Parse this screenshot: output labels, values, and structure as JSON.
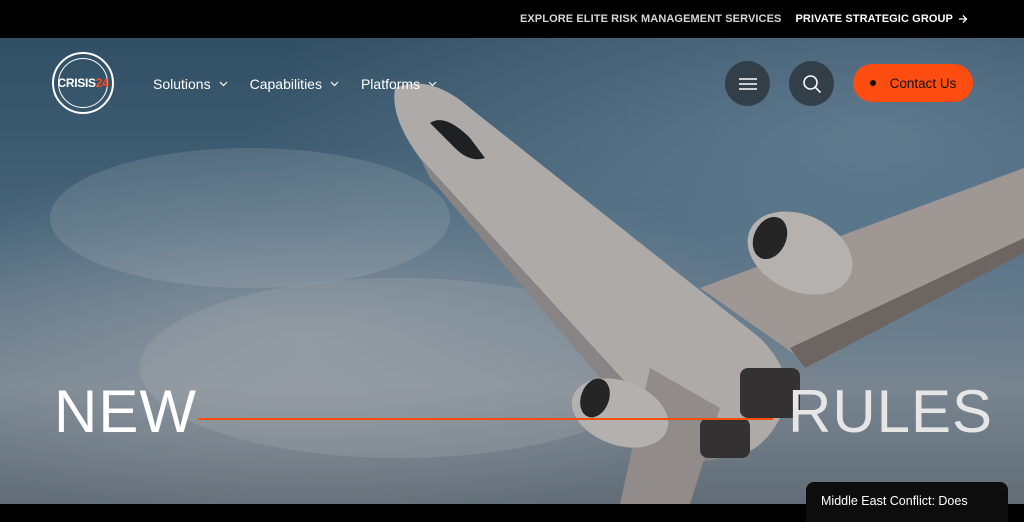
{
  "topbar": {
    "link1": "EXPLORE ELITE RISK MANAGEMENT SERVICES",
    "link2": "PRIVATE STRATEGIC GROUP"
  },
  "logo": {
    "text": "CRISIS",
    "number": "24"
  },
  "nav": [
    {
      "label": "Solutions"
    },
    {
      "label": "Capabilities"
    },
    {
      "label": "Platforms"
    }
  ],
  "actions": {
    "menu_icon": "hamburger-icon",
    "search_icon": "search-icon",
    "contact_label": "Contact Us"
  },
  "hero": {
    "word1": "NEW",
    "word2": "RULES"
  },
  "news": {
    "teaser": "Middle East Conflict: Does"
  },
  "colors": {
    "accent": "#ff4d12",
    "topbar": "#000000"
  }
}
